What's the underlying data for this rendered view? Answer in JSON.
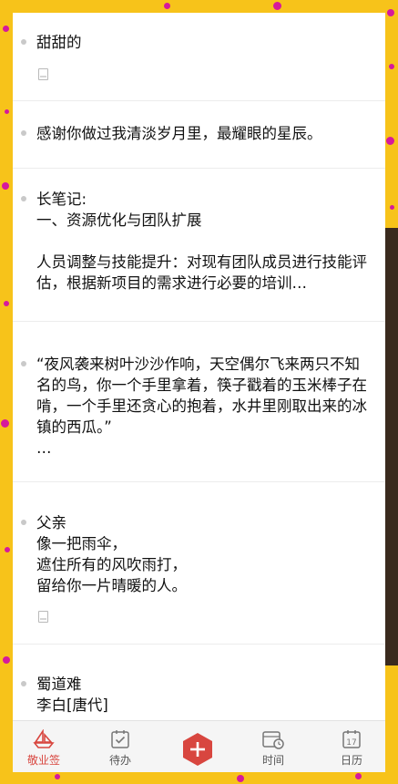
{
  "notes": [
    {
      "text": "甜甜的",
      "has_attachment": true
    },
    {
      "text": "感谢你做过我清淡岁月里，最耀眼的星辰。",
      "has_attachment": false
    },
    {
      "text": "长笔记:\n一、资源优化与团队扩展\n\n人员调整与技能提升：对现有团队成员进行技能评估，根据新项目的需求进行必要的培训…",
      "has_attachment": false
    },
    {
      "text": "“夜风袭来树叶沙沙作响，天空偶尔飞来两只不知名的鸟，你一个手里拿着，筷子戳着的玉米棒子在啃，一个手里还贪心的抱着，水井里刚取出来的冰镇的西瓜。”\n…",
      "has_attachment": false
    },
    {
      "text": "父亲\n像一把雨伞，\n遮住所有的风吹雨打，\n留给你一片晴暖的人。",
      "has_attachment": true
    },
    {
      "text": "蜀道难\n李白[唐代]",
      "has_attachment": false
    }
  ],
  "tabs": [
    {
      "label": "敬业签",
      "icon": "sailboat-icon",
      "active": true
    },
    {
      "label": "待办",
      "icon": "checklist-icon",
      "active": false
    },
    {
      "label": "",
      "icon": "plus-icon",
      "active": false
    },
    {
      "label": "时间",
      "icon": "calendar-clock-icon",
      "active": false
    },
    {
      "label": "日历",
      "icon": "calendar-icon",
      "active": false
    }
  ],
  "calendar_day": "17",
  "colors": {
    "accent": "#d8463f",
    "background": "#f7c31a",
    "dots": "#d6199c"
  }
}
